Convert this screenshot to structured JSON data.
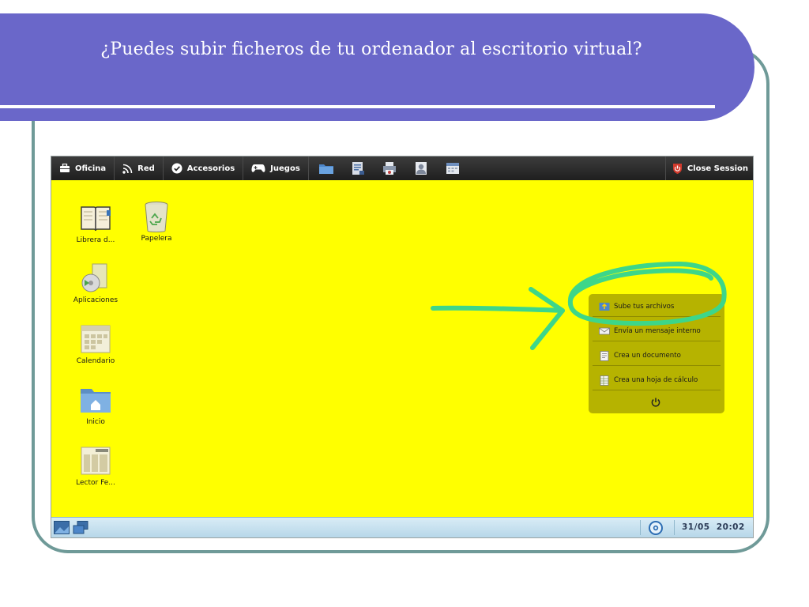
{
  "slide": {
    "title": "¿Puedes subir ficheros de tu ordenador al escritorio virtual?",
    "band_color": "#6a67c9",
    "frame_color": "#6f9a98"
  },
  "topbar": {
    "menus": [
      {
        "label": "Oficina",
        "icon": "briefcase-icon"
      },
      {
        "label": "Red",
        "icon": "rss-icon"
      },
      {
        "label": "Accesorios",
        "icon": "checkmark-icon"
      },
      {
        "label": "Juegos",
        "icon": "gamepad-icon"
      }
    ],
    "quick_icons": [
      "folder-icon",
      "document-icon",
      "printer-icon",
      "user-icon",
      "calendar-icon"
    ],
    "close_session_label": "Close Session"
  },
  "desktop": {
    "background": "#ffff00",
    "icons": [
      {
        "label": "Librera d...",
        "icon": "book-icon"
      },
      {
        "label": "Papelera",
        "icon": "recycle-bin-icon"
      },
      {
        "label": "Aplicaciones",
        "icon": "applications-icon"
      },
      {
        "label": "Calendario",
        "icon": "calendar-icon"
      },
      {
        "label": "Inicio",
        "icon": "home-folder-icon"
      },
      {
        "label": "Lector Fe...",
        "icon": "news-reader-icon"
      }
    ]
  },
  "quick_panel": {
    "items": [
      {
        "label": "Sube tus archivos",
        "icon": "upload-icon"
      },
      {
        "label": "Envía un mensaje interno",
        "icon": "envelope-icon"
      },
      {
        "label": "Crea un documento",
        "icon": "document-icon"
      },
      {
        "label": "Crea una hoja de cálculo",
        "icon": "spreadsheet-icon"
      }
    ],
    "power_icon": "power-icon"
  },
  "taskbar": {
    "date": "31/05",
    "time": "20:02"
  },
  "annotation": {
    "color": "#3dd68a",
    "shapes": [
      "arrow",
      "circle"
    ]
  }
}
